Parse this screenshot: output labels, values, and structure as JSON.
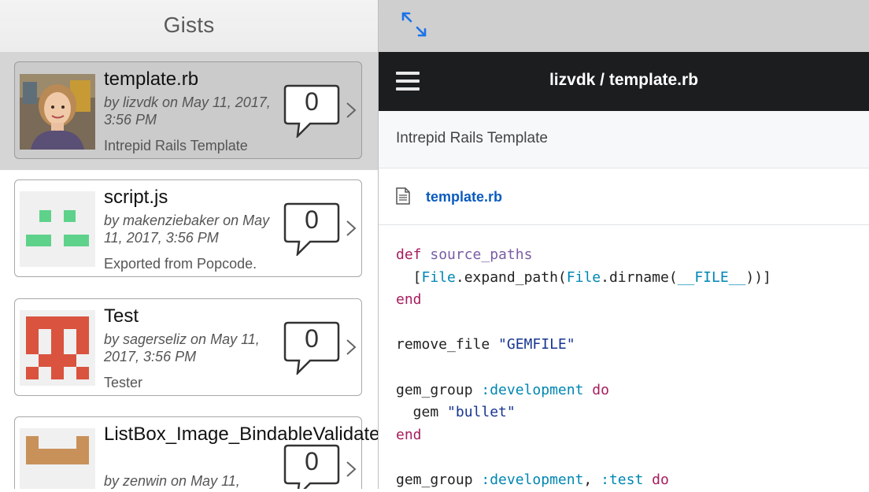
{
  "gists_pane": {
    "title": "Gists",
    "items": [
      {
        "title": "template.rb",
        "meta": "by lizvdk on May 11, 2017, 3:56 PM",
        "description": "Intrepid Rails Template",
        "comments": "0",
        "avatar": "photo-avatar"
      },
      {
        "title": "script.js",
        "meta": "by makenziebaker on May 11, 2017, 3:56 PM",
        "description": "Exported from Popcode.",
        "comments": "0",
        "avatar": "identicon-green"
      },
      {
        "title": "Test",
        "meta": "by sagerseliz on May 11, 2017, 3:56 PM",
        "description": "Tester",
        "comments": "0",
        "avatar": "identicon-red"
      },
      {
        "title": "ListBox_Image_BindableValidateE…",
        "meta": "by zenwin on May 11,",
        "description": "",
        "comments": "0",
        "avatar": "identicon-tan"
      }
    ]
  },
  "detail": {
    "nav_title": "lizvdk / template.rb",
    "description": "Intrepid Rails Template",
    "file_name": "template.rb",
    "code_lines": [
      "def source_paths",
      "  [File.expand_path(File.dirname(__FILE__))]",
      "end",
      "",
      "remove_file \"GEMFILE\"",
      "",
      "gem_group :development do",
      "  gem \"bullet\"",
      "end",
      "",
      "gem_group :development, :test do"
    ]
  },
  "icons": {
    "expand": "expand-arrows-icon",
    "menu": "hamburger-menu-icon",
    "file": "file-document-icon",
    "comment": "speech-bubble-icon",
    "chevron": "chevron-right-icon"
  },
  "colors": {
    "accent": "#1a73e8",
    "link": "#0a5bbf",
    "navbar": "#1b1d1f",
    "keyword": "#a71d5d",
    "function": "#795da3",
    "constant": "#0086b3",
    "string": "#183691"
  }
}
